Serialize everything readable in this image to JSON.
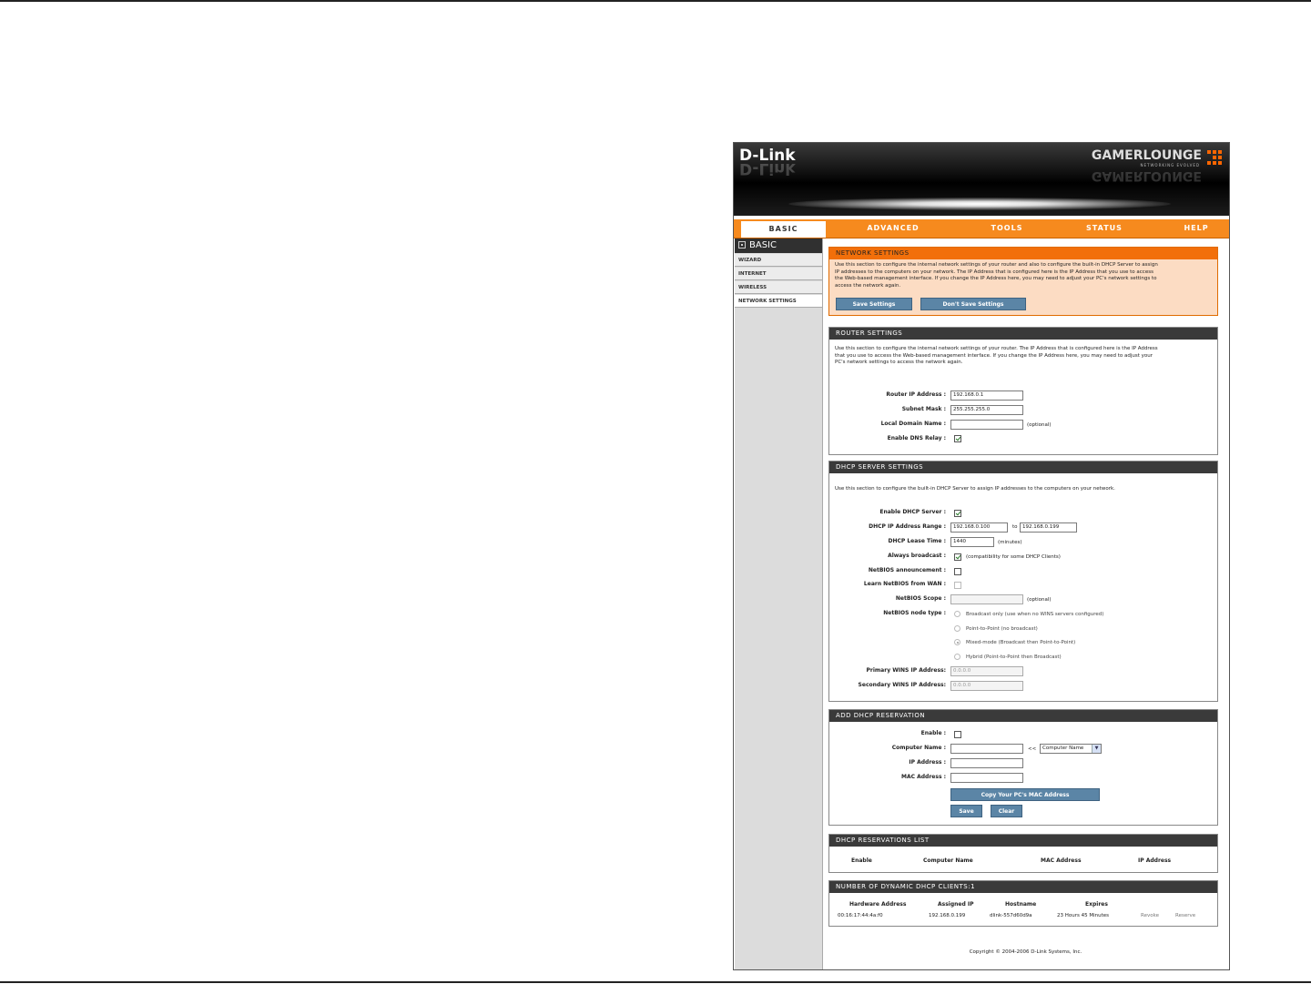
{
  "header": {
    "logo": "D-Link",
    "brand": "GAMERLOUNGE",
    "brand_tagline": "NETWORKING EVOLVED"
  },
  "tabs": [
    {
      "label": "BASIC",
      "active": true
    },
    {
      "label": "ADVANCED"
    },
    {
      "label": "TOOLS"
    },
    {
      "label": "STATUS"
    },
    {
      "label": "HELP"
    }
  ],
  "sidebar": {
    "title": "BASIC",
    "items": [
      {
        "label": "WIZARD"
      },
      {
        "label": "INTERNET"
      },
      {
        "label": "WIRELESS"
      },
      {
        "label": "NETWORK SETTINGS",
        "active": true
      }
    ]
  },
  "network_settings": {
    "title": "NETWORK SETTINGS",
    "desc_lines": [
      "Use this section to configure the internal network settings of your router and also to configure the built-in DHCP Server to assign",
      "IP addresses to the computers on your network. The IP Address that is configured here is the IP Address that you use to access",
      "the Web-based management interface. If you change the IP Address here, you may need to adjust your PC's network settings to",
      "access the network again."
    ],
    "save_label": "Save Settings",
    "dont_save_label": "Don't Save Settings"
  },
  "router_settings": {
    "title": "ROUTER SETTINGS",
    "desc_lines": [
      "Use this section to configure the internal network settings of your router. The IP Address that is configured here is the IP Address",
      "that you use to access the Web-based management interface. If you change the IP Address here, you may need to adjust your",
      "PC's network settings to access the network again."
    ],
    "ip_label": "Router IP Address :",
    "ip_value": "192.168.0.1",
    "mask_label": "Subnet Mask :",
    "mask_value": "255.255.255.0",
    "domain_label": "Local Domain Name :",
    "domain_value": "",
    "optional": "(optional)",
    "dns_label": "Enable DNS Relay :",
    "dns_checked": true
  },
  "dhcp_server": {
    "title": "DHCP SERVER SETTINGS",
    "desc": "Use this section to configure the built-in DHCP Server to assign IP addresses to the computers on your network.",
    "enable_label": "Enable DHCP Server :",
    "range_label": "DHCP IP Address Range :",
    "range_from": "192.168.0.100",
    "range_to_word": "to",
    "range_to": "192.168.0.199",
    "lease_label": "DHCP Lease Time :",
    "lease_value": "1440",
    "lease_unit": "(minutes)",
    "broadcast_label": "Always broadcast :",
    "broadcast_note": "(compatibility for some DHCP Clients)",
    "netbios_label": "NetBIOS announcement :",
    "learn_label": "Learn NetBIOS from WAN :",
    "scope_label": "NetBIOS Scope :",
    "scope_value": "",
    "optional": "(optional)",
    "node_label": "NetBIOS node type :",
    "node_options": [
      "Broadcast only (use when no WINS servers configured)",
      "Point-to-Point (no broadcast)",
      "Mixed-mode (Broadcast then Point-to-Point)",
      "Hybrid (Point-to-Point then Broadcast)"
    ],
    "node_selected": 2,
    "primary_wins_label": "Primary WINS IP Address:",
    "primary_wins_value": "0.0.0.0",
    "secondary_wins_label": "Secondary WINS IP Address:",
    "secondary_wins_value": "0.0.0.0"
  },
  "reservation": {
    "title": "ADD DHCP RESERVATION",
    "enable_label": "Enable :",
    "computer_label": "Computer Name :",
    "arrows": "<<",
    "select_value": "Computer Name",
    "ip_label": "IP Address :",
    "mac_label": "MAC Address :",
    "copy_mac_label": "Copy Your PC's MAC Address",
    "save_label": "Save",
    "clear_label": "Clear"
  },
  "reservations_list": {
    "title": "DHCP RESERVATIONS LIST",
    "columns": [
      "Enable",
      "Computer Name",
      "MAC Address",
      "IP Address"
    ]
  },
  "dynamic_clients": {
    "title": "NUMBER OF DYNAMIC DHCP CLIENTS:1",
    "columns": [
      "Hardware Address",
      "Assigned IP",
      "Hostname",
      "Expires"
    ],
    "rows": [
      {
        "hardware": "00:16:17:44:4a:f0",
        "ip": "192.168.0.199",
        "hostname": "dlink-557d60d9a",
        "expires": "23 Hours 45 Minutes",
        "revoke": "Revoke",
        "reserve": "Reserve"
      }
    ]
  },
  "footer": {
    "copyright": "Copyright © 2004-2006 D-Link Systems, Inc."
  }
}
